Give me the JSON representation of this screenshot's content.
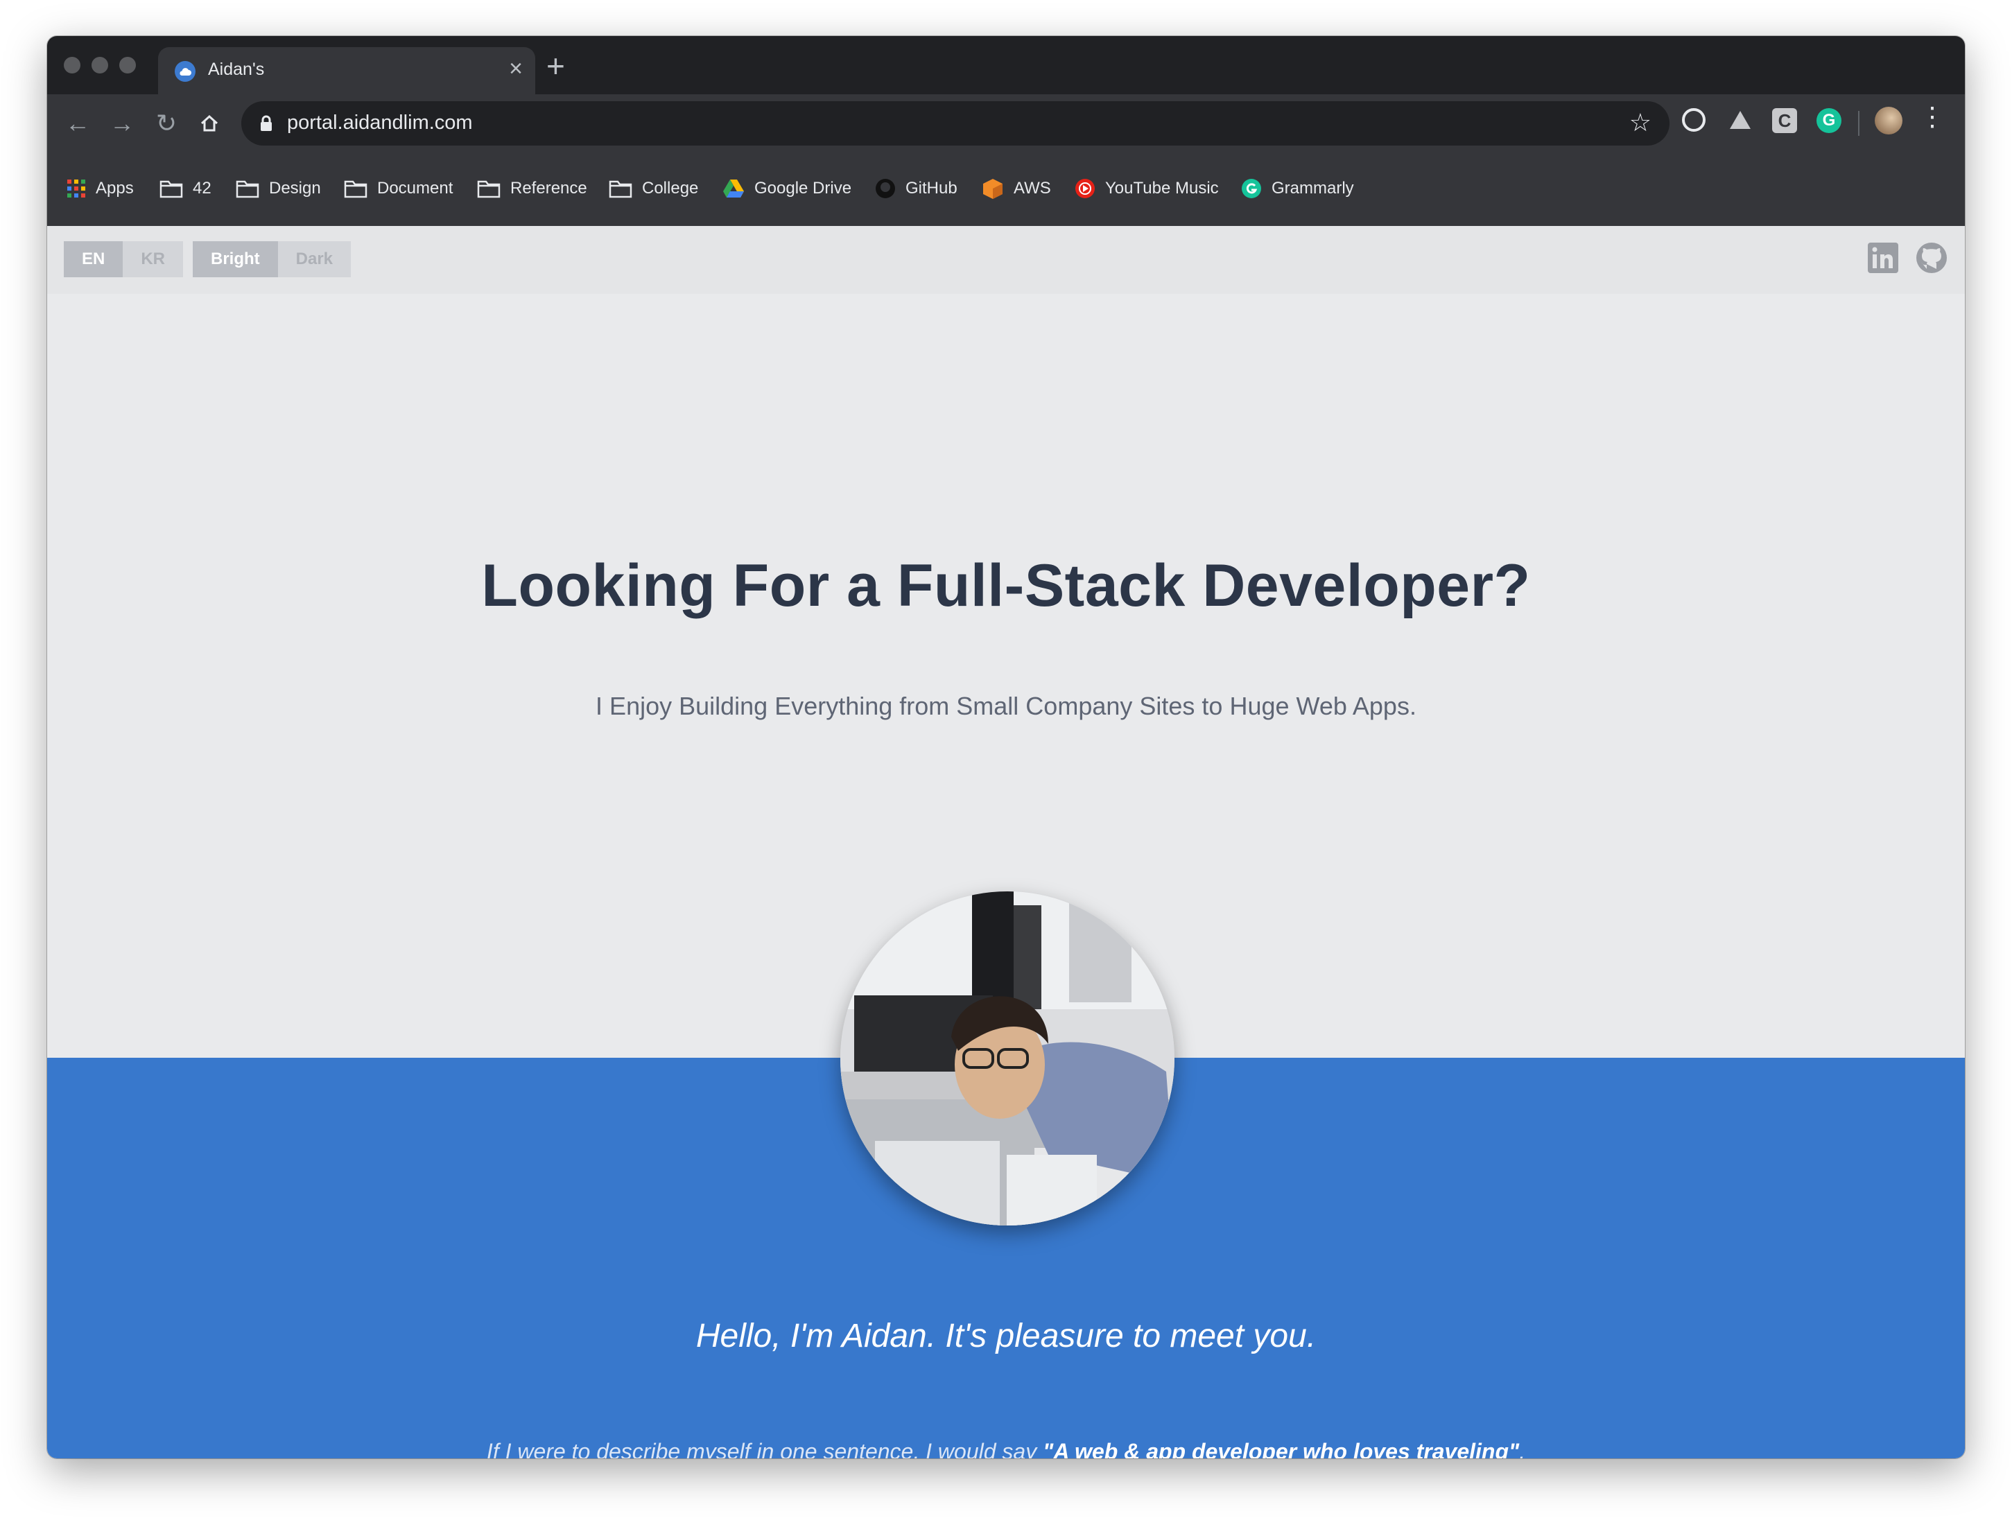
{
  "browser": {
    "tab_title": "Aidan's",
    "url": "portal.aidandlim.com",
    "bookmarks": [
      {
        "label": "Apps",
        "icon": "apps-grid-icon"
      },
      {
        "label": "42",
        "icon": "folder-icon"
      },
      {
        "label": "Design",
        "icon": "folder-icon"
      },
      {
        "label": "Document",
        "icon": "folder-icon"
      },
      {
        "label": "Reference",
        "icon": "folder-icon"
      },
      {
        "label": "College",
        "icon": "folder-icon"
      },
      {
        "label": "Google Drive",
        "icon": "google-drive-icon"
      },
      {
        "label": "GitHub",
        "icon": "github-icon"
      },
      {
        "label": "AWS",
        "icon": "aws-icon"
      },
      {
        "label": "YouTube Music",
        "icon": "youtube-music-icon"
      },
      {
        "label": "Grammarly",
        "icon": "grammarly-icon"
      }
    ],
    "extension_letter": "C",
    "grammarly_letter": "G"
  },
  "page": {
    "language_toggle": {
      "active": "EN",
      "inactive": "KR"
    },
    "theme_toggle": {
      "active": "Bright",
      "inactive": "Dark"
    },
    "hero_title": "Looking For a Full-Stack Developer?",
    "hero_subtitle": "I Enjoy Building Everything from Small Company Sites to Huge Web Apps.",
    "greeting": "Hello, I'm Aidan. It's pleasure to meet you.",
    "tagline_prefix": "If I were to describe myself in one sentence, I would say ",
    "tagline_quote": "\"A web & app developer who loves traveling\"",
    "tagline_suffix": "."
  },
  "colors": {
    "accent_blue": "#3878cc",
    "title_text": "#2c3648",
    "page_background": "#e9eaec"
  }
}
